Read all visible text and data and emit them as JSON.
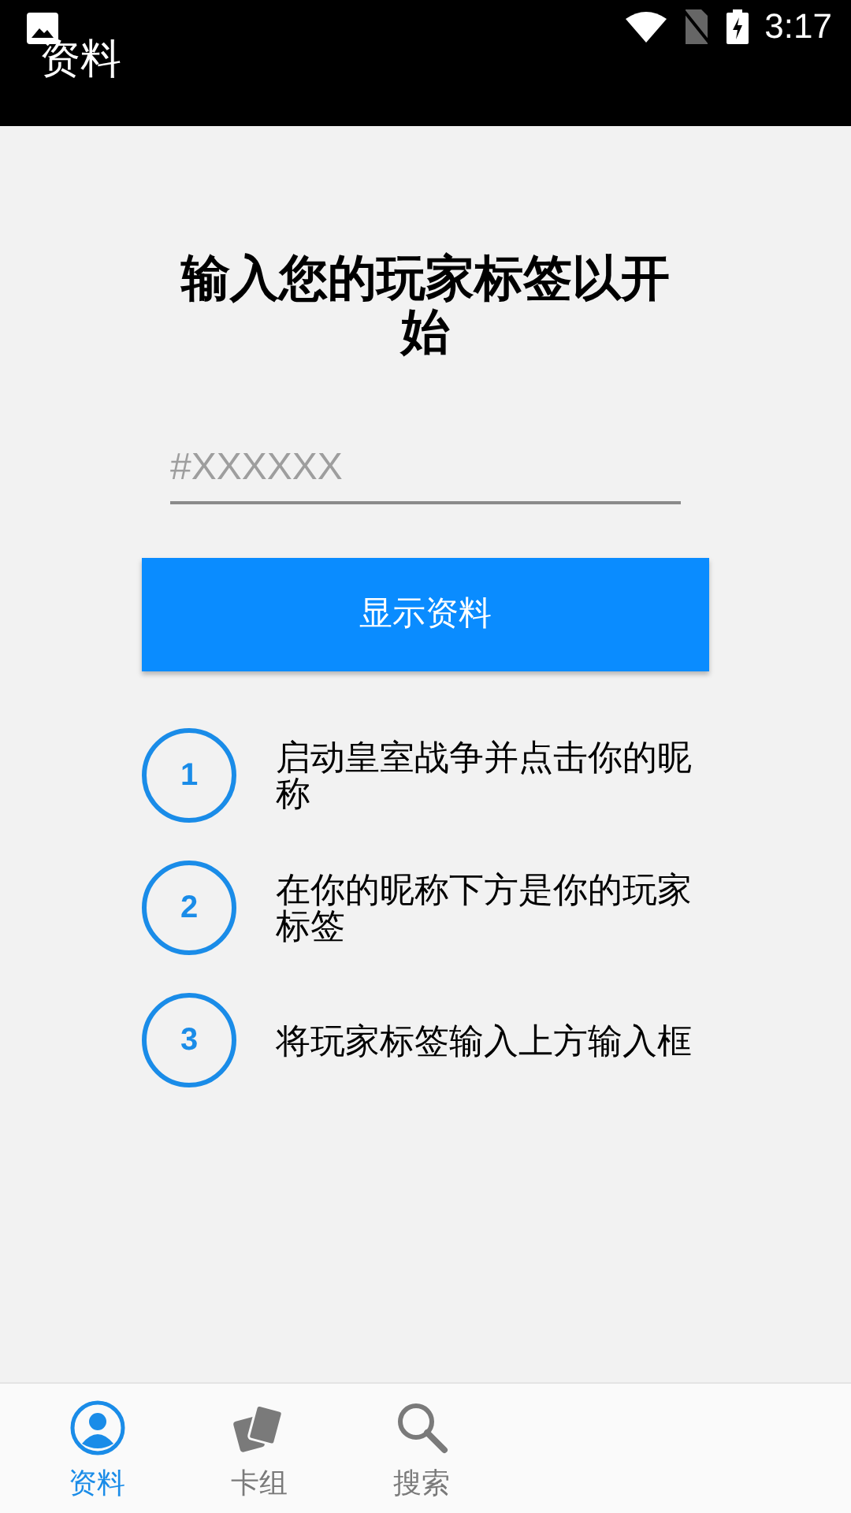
{
  "status_bar": {
    "time": "3:17"
  },
  "app_bar": {
    "title": "资料"
  },
  "heading": "输入您的玩家标签以开始",
  "tag_field": {
    "placeholder": "#XXXXXX"
  },
  "show_button": "显示资料",
  "steps": [
    {
      "number": "1",
      "text": "启动皇室战争并点击你的昵称"
    },
    {
      "number": "2",
      "text": "在你的昵称下方是你的玩家标签"
    },
    {
      "number": "3",
      "text": "将玩家标签输入上方输入框"
    }
  ],
  "bottom_nav": [
    {
      "kind": "profile",
      "label": "资料",
      "selected": true
    },
    {
      "kind": "cards",
      "label": "卡组",
      "selected": false
    },
    {
      "kind": "search",
      "label": "搜索",
      "selected": false
    }
  ]
}
